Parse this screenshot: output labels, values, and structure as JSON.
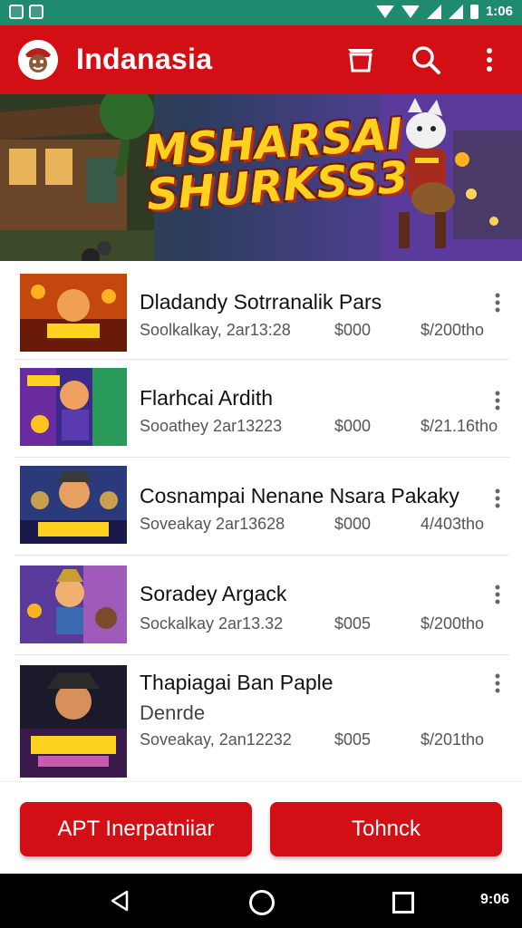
{
  "status_bar": {
    "time": "1:06"
  },
  "app_bar": {
    "title": "Indanasia"
  },
  "banner": {
    "title_line1": "MSHARSAI",
    "title_line2": "SHURKSS3"
  },
  "list": [
    {
      "title": "Dladandy Sotrranalik Pars",
      "subtitle": "",
      "meta_date": "Soolkalkay, 2ar13:28",
      "meta_price": "$000",
      "meta_extra": "$/200tho"
    },
    {
      "title": "Flarhcai Ardith",
      "subtitle": "",
      "meta_date": "Sooathey 2ar13223",
      "meta_price": "$000",
      "meta_extra": "$/21.16tho"
    },
    {
      "title": "Cosnampai Nenane Nsara Pakaky",
      "subtitle": "",
      "meta_date": "Soveakay 2ar13628",
      "meta_price": "$000",
      "meta_extra": "4/403tho"
    },
    {
      "title": "Soradey Argack",
      "subtitle": "",
      "meta_date": "Sockalkay 2ar13.32",
      "meta_price": "$005",
      "meta_extra": "$/200tho"
    },
    {
      "title": "Thapiagai Ban Paple",
      "subtitle": "Denrde",
      "meta_date": "Soveakay, 2an12232",
      "meta_price": "$005",
      "meta_extra": "$/201tho"
    }
  ],
  "buttons": {
    "left_label": "APT Inerpatniiar",
    "right_label": "Tohnck"
  },
  "nav_bar": {
    "time": "9:06"
  },
  "colors": {
    "primary_red": "#d10f14",
    "status_green": "#1e8a6e"
  }
}
